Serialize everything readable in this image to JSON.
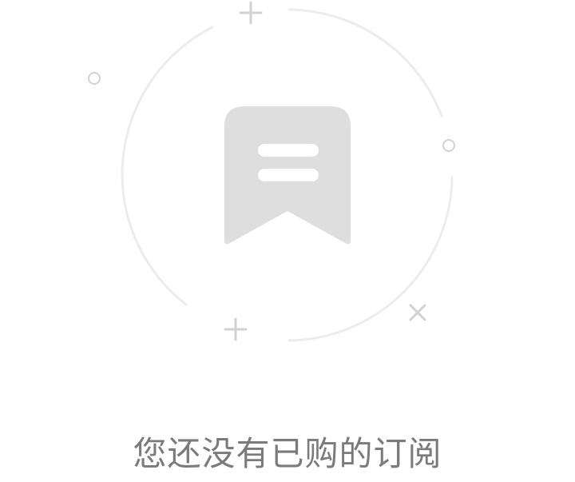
{
  "empty_state": {
    "message": "您还没有已购的订阅",
    "icon": "bookmark-icon",
    "decorations": [
      "plus-icon",
      "plus-icon",
      "circle-icon",
      "circle-icon",
      "close-icon"
    ]
  },
  "colors": {
    "background": "#ffffff",
    "icon_fill": "#dedede",
    "ring": "#ececec",
    "decoration": "#d2d2d2",
    "text": "#7b7b7b"
  }
}
